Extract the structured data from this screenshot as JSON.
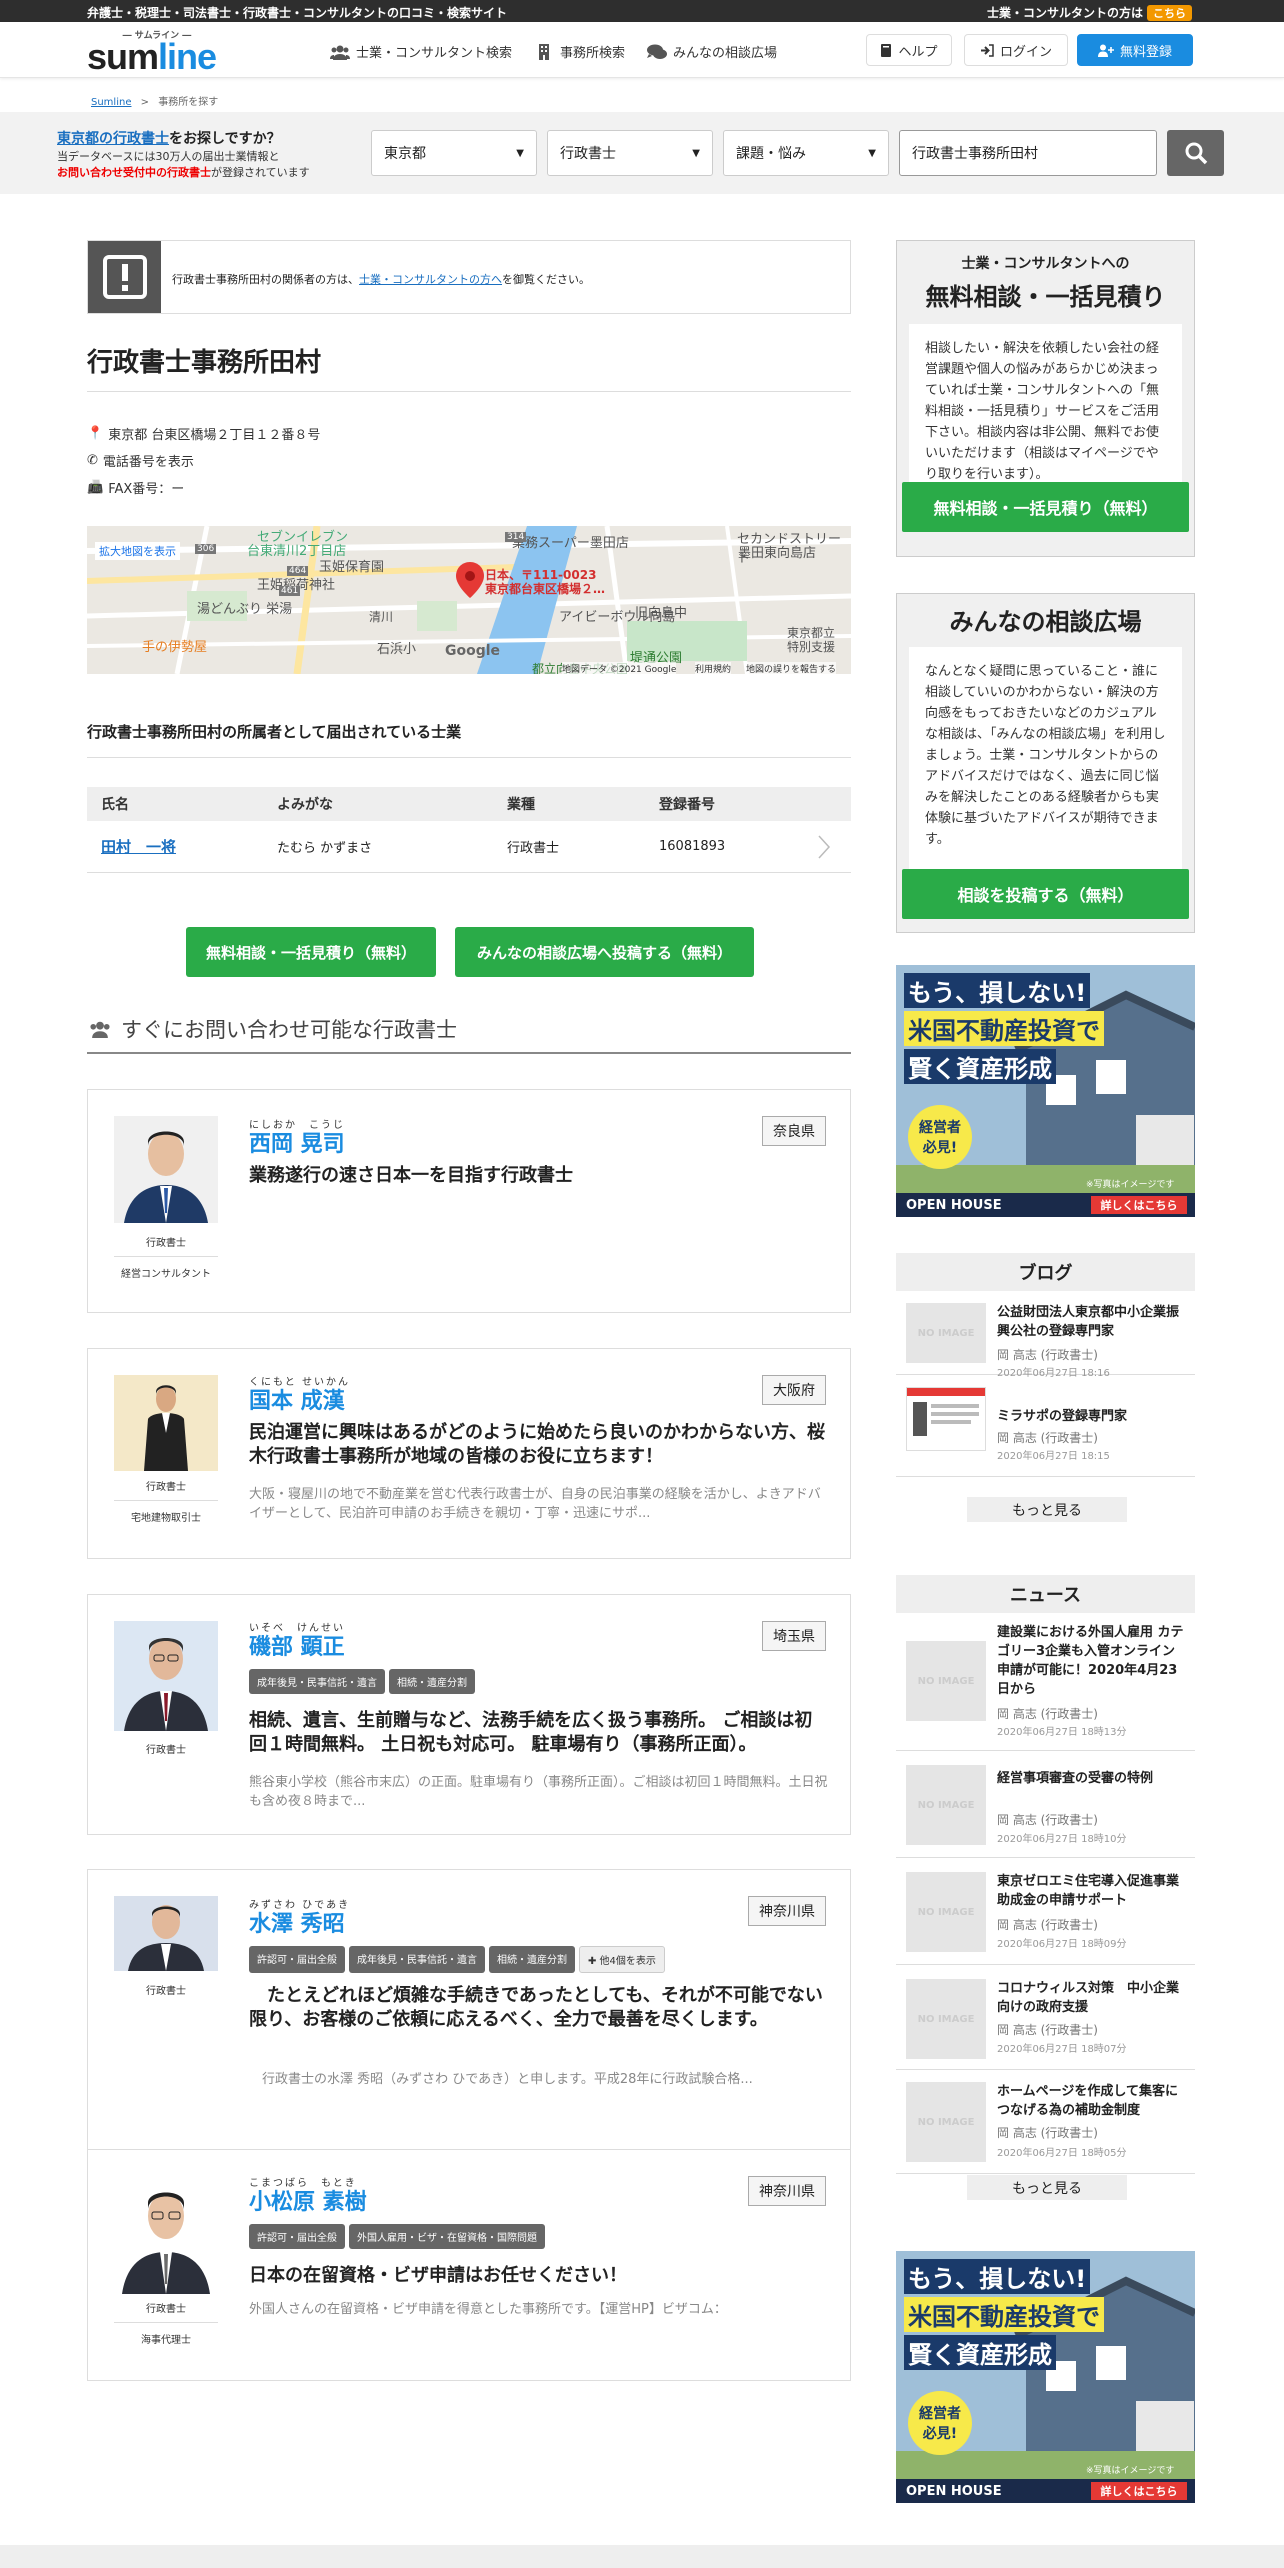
{
  "topbar": {
    "tagline": "弁護士・税理士・司法書士・行政書士・コンサルタントの口コミ・検索サイト",
    "consultant_q": "士業・コンサルタントの方は",
    "kochira": "こちら"
  },
  "logo": {
    "small": "― サムライン ―",
    "sum": "sum",
    "line": "line"
  },
  "nav": {
    "search": "士業・コンサルタント検索",
    "office": "事務所検索",
    "forum": "みんなの相談広場"
  },
  "header_buttons": {
    "help": "ヘルプ",
    "login": "ログイン",
    "register": "無料登録"
  },
  "breadcrumb": {
    "home": "Sumline",
    "sep": ">",
    "current": "事務所を探す"
  },
  "search": {
    "q_blue": "東京都の行政書士",
    "q_rest": "をお探しですか？",
    "line2": "当データベースには30万人の届出士業情報と",
    "red": "お問い合わせ受付中の行政書士",
    "line3": "が登録されています",
    "pref": "東京都",
    "job": "行政書士",
    "topic": "課題・悩み",
    "keyword": "行政書士事務所田村"
  },
  "notice": {
    "pre": "行政書士事務所田村の関係者の方は、",
    "link": "士業・コンサルタントの方へ",
    "post": "を御覧ください。"
  },
  "office": {
    "name": "行政書士事務所田村",
    "address": "東京都 台東区橋場２丁目１２番８号",
    "tel": "電話番号を表示",
    "fax": "FAX番号：ー"
  },
  "map": {
    "enlarge": "拡大地図を表示",
    "pin1": "日本、〒111-0023",
    "pin2": "東京都台東区橋場２…",
    "labels": [
      "セブンイレブン",
      "台東清川2丁目店",
      "玉姫保育園",
      "王姫稲荷神社",
      "湯どんぶり 栄湯",
      "手の伊勢屋",
      "石浜小",
      "業務スーパー墨田店",
      "セカンドストリート",
      "墨田東向島店",
      "旧向島中",
      "アイビーボウル向島",
      "堤通公園",
      "都立向島中央公園",
      "東京都立",
      "特別支援",
      "清川",
      "Google",
      "地図データ ©2021 Google",
      "利用規約",
      "地図の誤りを報告する",
      "314",
      "464",
      "461",
      "306"
    ]
  },
  "members": {
    "heading": "行政書士事務所田村の所属者として届出されている士業",
    "headers": [
      "氏名",
      "よみがな",
      "業種",
      "登録番号"
    ],
    "rows": [
      {
        "name": "田村　一将",
        "kana": "たむら かずまさ",
        "job": "行政書士",
        "no": "16081893"
      }
    ]
  },
  "cta": {
    "consult": "無料相談・一括見積り（無料）",
    "post": "みんなの相談広場へ投稿する（無料）"
  },
  "section": {
    "title": "すぐにお問い合わせ可能な行政書士"
  },
  "cards": [
    {
      "kana": "にしおか　こうじ",
      "name": "西岡 晃司",
      "pref": "奈良県",
      "role": "行政書士",
      "sub": "経営コンサルタント",
      "catch": "業務遂行の速さ日本一を目指す行政書士",
      "desc": "",
      "tags": []
    },
    {
      "kana": "くにもと せいかん",
      "name": "国本 成漢",
      "pref": "大阪府",
      "role": "行政書士",
      "sub": "宅地建物取引士",
      "catch": "民泊運営に興味はあるがどのように始めたら良いのかわからない方、桜木行政書士事務所が地域の皆様のお役に立ちます！",
      "desc": "大阪・寝屋川の地で不動産業を営む代表行政書士が、自身の民泊事業の経験を活かし、よきアドバイザーとして、民泊許可申請のお手続きを親切・丁寧・迅速にサポ...",
      "tags": []
    },
    {
      "kana": "いそべ　けんせい",
      "name": "磯部 顕正",
      "pref": "埼玉県",
      "role": "行政書士",
      "sub": "",
      "catch": "相続、遺言、生前贈与など、法務手続を広く扱う事務所。 ご相談は初回１時間無料。 土日祝も対応可。 駐車場有り（事務所正面）。",
      "desc": "熊谷東小学校（熊谷市末広）の正面。駐車場有り（事務所正面）。ご相談は初回１時間無料。土日祝も含め夜８時まで...",
      "tags": [
        "成年後見・民事信託・遺言",
        "相続・遺産分割"
      ]
    },
    {
      "kana": "みずさわ ひであき",
      "name": "水澤 秀昭",
      "pref": "神奈川県",
      "role": "行政書士",
      "sub": "",
      "catch": "　たとえどれほど煩雑な手続きであったとしても、それが不可能でない限り、お客様のご依頼に応えるべく、全力で最善を尽くします。",
      "desc": "　行政書士の水澤 秀昭（みずさわ ひであき）と申します。平成28年に行政試験合格...",
      "tags": [
        "許認可・届出全般",
        "成年後見・民事信託・遺言",
        "相続・遺産分割",
        "✚ 他4個を表示"
      ]
    },
    {
      "kana": "こまつばら　もとき",
      "name": "小松原 素樹",
      "pref": "神奈川県",
      "role": "行政書士",
      "sub": "海事代理士",
      "catch": "日本の在留資格・ビザ申請はお任せください！",
      "desc": "外国人さんの在留資格・ビザ申請を得意とした事務所です。【運営HP】ビザコム：",
      "tags": [
        "許認可・届出全般",
        "外国人雇用・ビザ・在留資格・国際問題"
      ]
    }
  ],
  "side_consult": {
    "h1": "士業・コンサルタントへの",
    "h2": "無料相談・一括見積り",
    "body": "相談したい・解決を依頼したい会社の経営課題や個人の悩みがあらかじめ決まっていれば士業・コンサルタントへの「無料相談・一括見積り」サービスをご活用下さい。相談内容は非公開、無料でお使いいただけます（相談はマイページでやり取りを行います）。",
    "btn": "無料相談・一括見積り（無料）"
  },
  "side_forum": {
    "h2": "みんなの相談広場",
    "body": "なんとなく疑問に思っていること・誰に相談していいのかわからない・解決の方向感をもっておきたいなどのカジュアルな相談は、「みんなの相談広場」を利用しましょう。士業・コンサルタントからのアドバイスだけではなく、過去に同じ悩みを解決したことのある経験者からも実体験に基づいたアドバイスが期待できます。",
    "btn": "相談を投稿する（無料）"
  },
  "ad": {
    "l1": "もう、損しない!",
    "l2": "米国不動産投資で",
    "l3": "賢く資産形成",
    "badge1": "経営者",
    "badge2": "必見!",
    "note": "※写真はイメージです",
    "brand": "OPEN HOUSE",
    "detail": "詳しくはこちら"
  },
  "blog": {
    "title": "ブログ",
    "items": [
      {
        "title": "公益財団法人東京都中小企業振興公社の登録専門家",
        "author": "岡 高志 (行政書士)",
        "date": "2020年06月27日 18:16"
      },
      {
        "title": "ミラサポの登録専門家",
        "author": "岡 高志 (行政書士)",
        "date": "2020年06月27日 18:15"
      }
    ],
    "more": "もっと見る"
  },
  "news": {
    "title": "ニュース",
    "items": [
      {
        "title": "建設業における外国人雇用 カテゴリー3企業も入管オンライン申請が可能に！2020年4月23日から",
        "author": "岡 高志 (行政書士)",
        "date": "2020年06月27日 18時13分"
      },
      {
        "title": "経営事項審査の受審の特例",
        "author": "岡 高志 (行政書士)",
        "date": "2020年06月27日 18時10分"
      },
      {
        "title": "東京ゼロエミ住宅導入促進事業　助成金の申請サポート",
        "author": "岡 高志 (行政書士)",
        "date": "2020年06月27日 18時09分"
      },
      {
        "title": "コロナウィルス対策　中小企業向けの政府支援",
        "author": "岡 高志 (行政書士)",
        "date": "2020年06月27日 18時07分"
      },
      {
        "title": "ホームページを作成して集客につなげる為の補助金制度",
        "author": "岡 高志 (行政書士)",
        "date": "2020年06月27日 18時05分"
      }
    ],
    "more": "もっと見る",
    "noimage": "NO IMAGE"
  },
  "colors": {
    "brand_blue": "#1a8ce0",
    "green": "#2aab48",
    "orange": "#f39800"
  }
}
